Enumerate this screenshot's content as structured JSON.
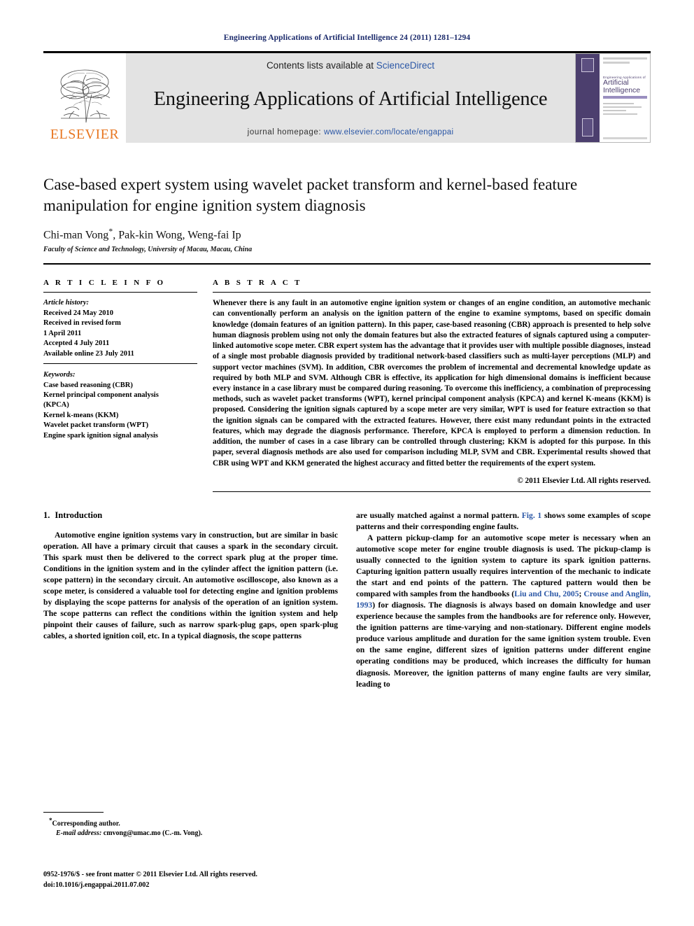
{
  "running_head": "Engineering Applications of Artificial Intelligence 24 (2011) 1281–1294",
  "masthead": {
    "publisher_name": "ELSEVIER",
    "contents_prefix": "Contents lists available at ",
    "contents_link": "ScienceDirect",
    "journal_title": "Engineering Applications of Artificial Intelligence",
    "homepage_prefix": "journal homepage: ",
    "homepage_link": "www.elsevier.com/locate/engappai",
    "cover": {
      "kicker": "Engineering Applications of",
      "line1": "Artificial",
      "line2": "Intelligence"
    }
  },
  "article": {
    "title": "Case-based expert system using wavelet packet transform and kernel-based feature manipulation for engine ignition system diagnosis",
    "authors": "Chi-man Vong*, Pak-kin Wong, Weng-fai Ip",
    "affiliation": "Faculty of Science and Technology, University of Macau, Macau, China"
  },
  "info": {
    "heading": "A R T I C L E  I N F O",
    "history_label": "Article history:",
    "history": [
      "Received 24 May 2010",
      "Received in revised form",
      "1 April 2011",
      "Accepted 4 July 2011",
      "Available online 23 July 2011"
    ],
    "keywords_label": "Keywords:",
    "keywords": [
      "Case based reasoning (CBR)",
      "Kernel principal component analysis",
      "(KPCA)",
      "Kernel k-means (KKM)",
      "Wavelet packet transform (WPT)",
      "Engine spark ignition signal analysis"
    ]
  },
  "abstract": {
    "heading": "A B S T R A C T",
    "text": "Whenever there is any fault in an automotive engine ignition system or changes of an engine condition, an automotive mechanic can conventionally perform an analysis on the ignition pattern of the engine to examine symptoms, based on specific domain knowledge (domain features of an ignition pattern). In this paper, case-based reasoning (CBR) approach is presented to help solve human diagnosis problem using not only the domain features but also the extracted features of signals captured using a computer-linked automotive scope meter. CBR expert system has the advantage that it provides user with multiple possible diagnoses, instead of a single most probable diagnosis provided by traditional network-based classifiers such as multi-layer perceptions (MLP) and support vector machines (SVM). In addition, CBR overcomes the problem of incremental and decremental knowledge update as required by both MLP and SVM. Although CBR is effective, its application for high dimensional domains is inefficient because every instance in a case library must be compared during reasoning. To overcome this inefficiency, a combination of preprocessing methods, such as wavelet packet transforms (WPT), kernel principal component analysis (KPCA) and kernel K-means (KKM) is proposed. Considering the ignition signals captured by a scope meter are very similar, WPT is used for feature extraction so that the ignition signals can be compared with the extracted features. However, there exist many redundant points in the extracted features, which may degrade the diagnosis performance. Therefore, KPCA is employed to perform a dimension reduction. In addition, the number of cases in a case library can be controlled through clustering; KKM is adopted for this purpose. In this paper, several diagnosis methods are also used for comparison including MLP, SVM and CBR. Experimental results showed that CBR using WPT and KKM generated the highest accuracy and fitted better the requirements of the expert system.",
    "copyright": "© 2011 Elsevier Ltd. All rights reserved."
  },
  "body": {
    "section_number": "1.",
    "section_title": "Introduction",
    "left_p1": "Automotive engine ignition systems vary in construction, but are similar in basic operation. All have a primary circuit that causes a spark in the secondary circuit. This spark must then be delivered to the correct spark plug at the proper time. Conditions in the ignition system and in the cylinder affect the ignition pattern (i.e. scope pattern) in the secondary circuit. An automotive oscilloscope, also known as a scope meter, is considered a valuable tool for detecting engine and ignition problems by displaying the scope patterns for analysis of the operation of an ignition system. The scope patterns can reflect the conditions within the ignition system and help pinpoint their causes of failure, such as narrow spark-plug gaps, open spark-plug cables, a shorted ignition coil, etc. In a typical diagnosis, the scope patterns",
    "right_p1_a": "are usually matched against a normal pattern. ",
    "right_p1_fig": "Fig. 1",
    "right_p1_b": " shows some examples of scope patterns and their corresponding engine faults.",
    "right_p2_a": "A pattern pickup-clamp for an automotive scope meter is necessary when an automotive scope meter for engine trouble diagnosis is used. The pickup-clamp is usually connected to the ignition system to capture its spark ignition patterns. Capturing ignition pattern usually requires intervention of the mechanic to indicate the start and end points of the pattern. The captured pattern would then be compared with samples from the handbooks (",
    "right_p2_cite1": "Liu and Chu, 2005",
    "right_p2_mid": "; ",
    "right_p2_cite2": "Crouse and Anglin, 1993",
    "right_p2_b": ") for diagnosis. The diagnosis is always based on domain knowledge and user experience because the samples from the handbooks are for reference only. However, the ignition patterns are time-varying and non-stationary. Different engine models produce various amplitude and duration for the same ignition system trouble. Even on the same engine, different sizes of ignition patterns under different engine operating conditions may be produced, which increases the difficulty for human diagnosis. Moreover, the ignition patterns of many engine faults are very similar, leading to"
  },
  "footnote": {
    "corresponding": "Corresponding author.",
    "email_label": "E-mail address:",
    "email": "cmvong@umac.mo (C.-m. Vong)."
  },
  "imprint": {
    "line1": "0952-1976/$ - see front matter © 2011 Elsevier Ltd. All rights reserved.",
    "line2": "doi:10.1016/j.engappai.2011.07.002"
  },
  "colors": {
    "running_head": "#1b2a6b",
    "link": "#2b57a6",
    "elsevier_orange": "#E87722",
    "cover_purple": "#4c3f6e",
    "masthead_gray": "#e3e3e3"
  }
}
